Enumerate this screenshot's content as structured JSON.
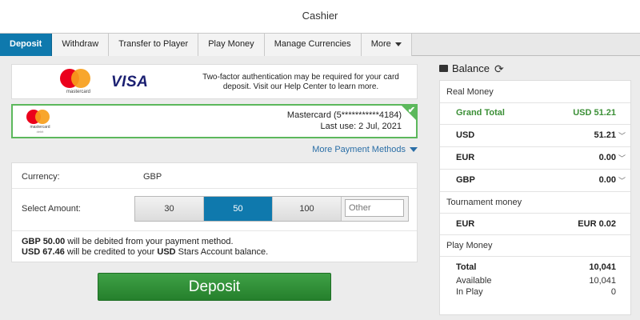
{
  "window": {
    "title": "Cashier"
  },
  "tabs": [
    {
      "label": "Deposit",
      "active": true
    },
    {
      "label": "Withdraw"
    },
    {
      "label": "Transfer to Player"
    },
    {
      "label": "Play Money"
    },
    {
      "label": "Manage Currencies"
    },
    {
      "label": "More",
      "has_dropdown": true
    }
  ],
  "card_banner": {
    "mastercard_logo_text": "mastercard",
    "visa_logo_text": "VISA",
    "notice": "Two-factor authentication may be required for your card deposit. Visit our Help Center to learn more."
  },
  "saved_card": {
    "logo_text": "mastercard",
    "logo_subtext": "debit",
    "number": "Mastercard (5***********4184)",
    "last_use": "Last use: 2 Jul, 2021",
    "selected": true,
    "check_icon": "checkmark-icon"
  },
  "more_payment_methods": "More Payment Methods",
  "form": {
    "currency_label": "Currency:",
    "currency_value": "GBP",
    "amount_label": "Select Amount:",
    "amounts": [
      "30",
      "50",
      "100"
    ],
    "selected_amount": "50",
    "other_placeholder": "Other",
    "note_line1_bold": "GBP 50.00",
    "note_line1_rest": " will be debited from your payment method.",
    "note_line2_bold1": "USD 67.46",
    "note_line2_mid": " will be credited to your ",
    "note_line2_bold2": "USD",
    "note_line2_rest": " Stars Account balance."
  },
  "deposit_button": "Deposit",
  "balance": {
    "title": "Balance",
    "real_money_label": "Real Money",
    "grand_total_label": "Grand Total",
    "grand_total_value": "USD 51.21",
    "currencies": [
      {
        "code": "USD",
        "value": "51.21"
      },
      {
        "code": "EUR",
        "value": "0.00"
      },
      {
        "code": "GBP",
        "value": "0.00"
      }
    ],
    "tournament_label": "Tournament money",
    "tournament_code": "EUR",
    "tournament_value": "EUR 0.02",
    "play_money_label": "Play Money",
    "play_total_label": "Total",
    "play_total_value": "10,041",
    "available_label": "Available",
    "available_value": "10,041",
    "in_play_label": "In Play",
    "in_play_value": "0"
  },
  "colors": {
    "accent": "#0f79ad",
    "success": "#3b8f36",
    "button": "#2e8f35",
    "link": "#2a6ea6"
  }
}
